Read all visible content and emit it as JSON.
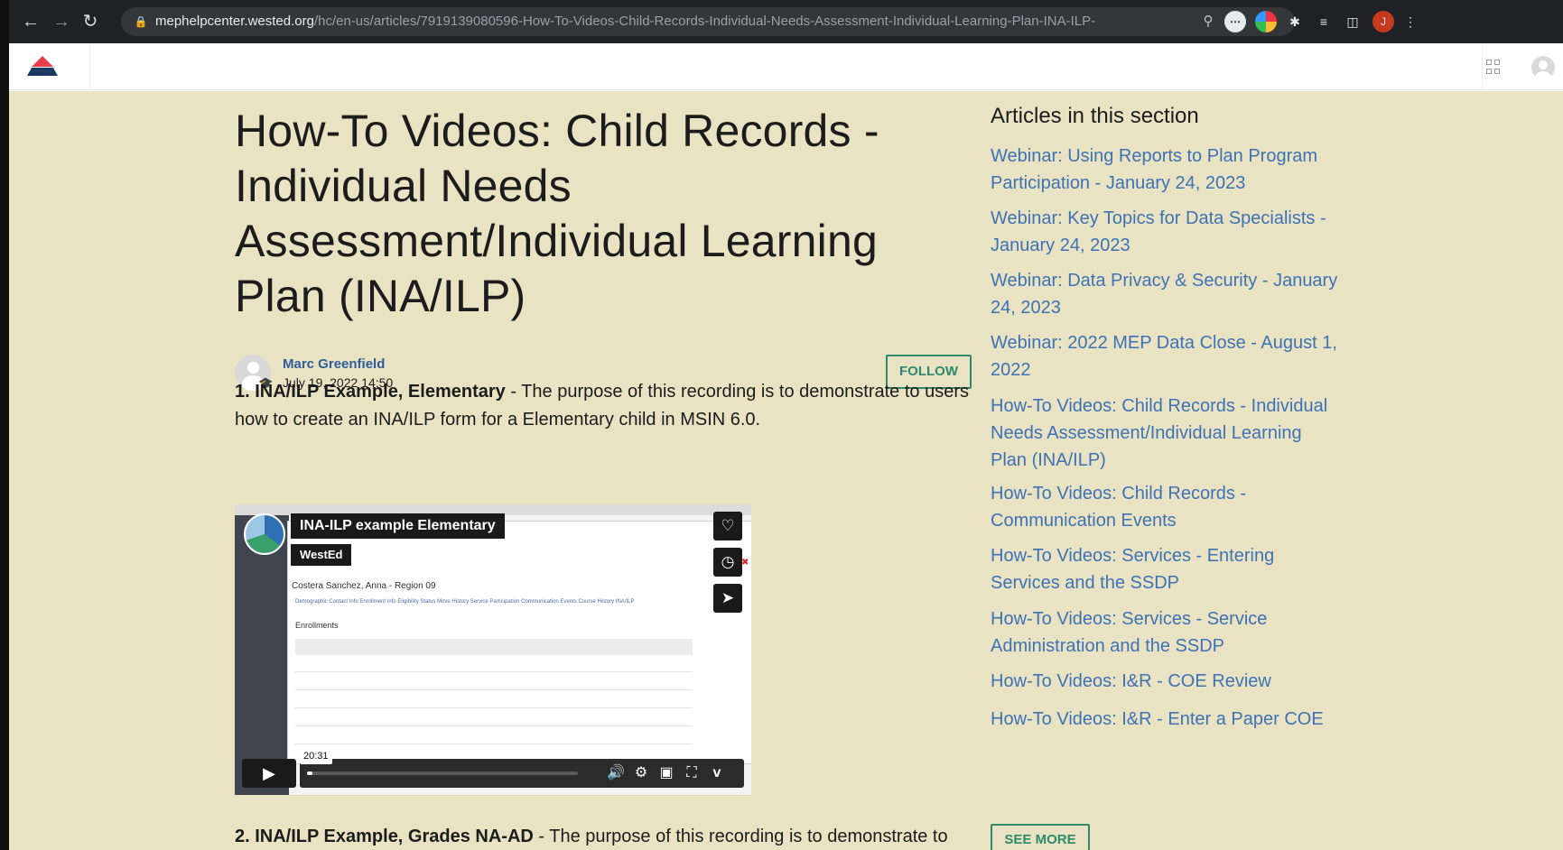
{
  "browser": {
    "url_host": "mephelpcenter.wested.org",
    "url_path": "/hc/en-us/articles/7919139080596-How-To-Videos-Child-Records-Individual-Needs-Assessment-Individual-Learning-Plan-INA-ILP-",
    "profile_initial": "J"
  },
  "article": {
    "title": "How-To Videos: Child Records - Individual Needs Assessment/Individual Learning Plan (INA/ILP)",
    "author_name": "Marc Greenfield",
    "date": "July 19, 2022 14:50",
    "follow_label": "FOLLOW",
    "item1_bold": "1. INA/ILP Example, Elementary",
    "item1_text": " - The purpose of this recording is to demonstrate to users how to create an INA/ILP form for a Elementary child in MSIN 6.0.",
    "item2_bold": "2. INA/ILP Example, Grades NA-AD",
    "item2_text": " - The purpose of this recording is to demonstrate to"
  },
  "video": {
    "title": "INA-ILP example Elementary",
    "channel": "WestEd",
    "duration": "20:31",
    "screen_student": "Costera Sanchez, Anna - Region 09",
    "screen_tabs": "Demographic    Contact Info    Enrollment Info    Eligibility Status    Move History    Service Participation    Communication Events    Course History    INA/ILP",
    "screen_heading": "Enrollments",
    "progress": 0.02
  },
  "sidebar": {
    "heading": "Articles in this section",
    "links": [
      "Webinar: Using Reports to Plan Program Participation - January 24, 2023",
      "Webinar: Key Topics for Data Specialists - January 24, 2023",
      "Webinar: Data Privacy & Security - January 24, 2023",
      "Webinar: 2022 MEP Data Close - August 1, 2022",
      "How-To Videos: Child Records - Individual Needs Assessment/Individual Learning Plan (INA/ILP)",
      "How-To Videos: Child Records - Communication Events",
      "How-To Videos: Services - Entering Services and the SSDP",
      "How-To Videos: Services - Service Administration and the SSDP",
      "How-To Videos: I&R - COE Review",
      "How-To Videos: I&R - Enter a Paper COE"
    ],
    "see_more_label": "SEE MORE"
  },
  "colors": {
    "page_bg": "#e9e3c3",
    "link": "#3d72b5",
    "accent_green": "#2e8a6d",
    "brand_red": "#e83e4c"
  }
}
